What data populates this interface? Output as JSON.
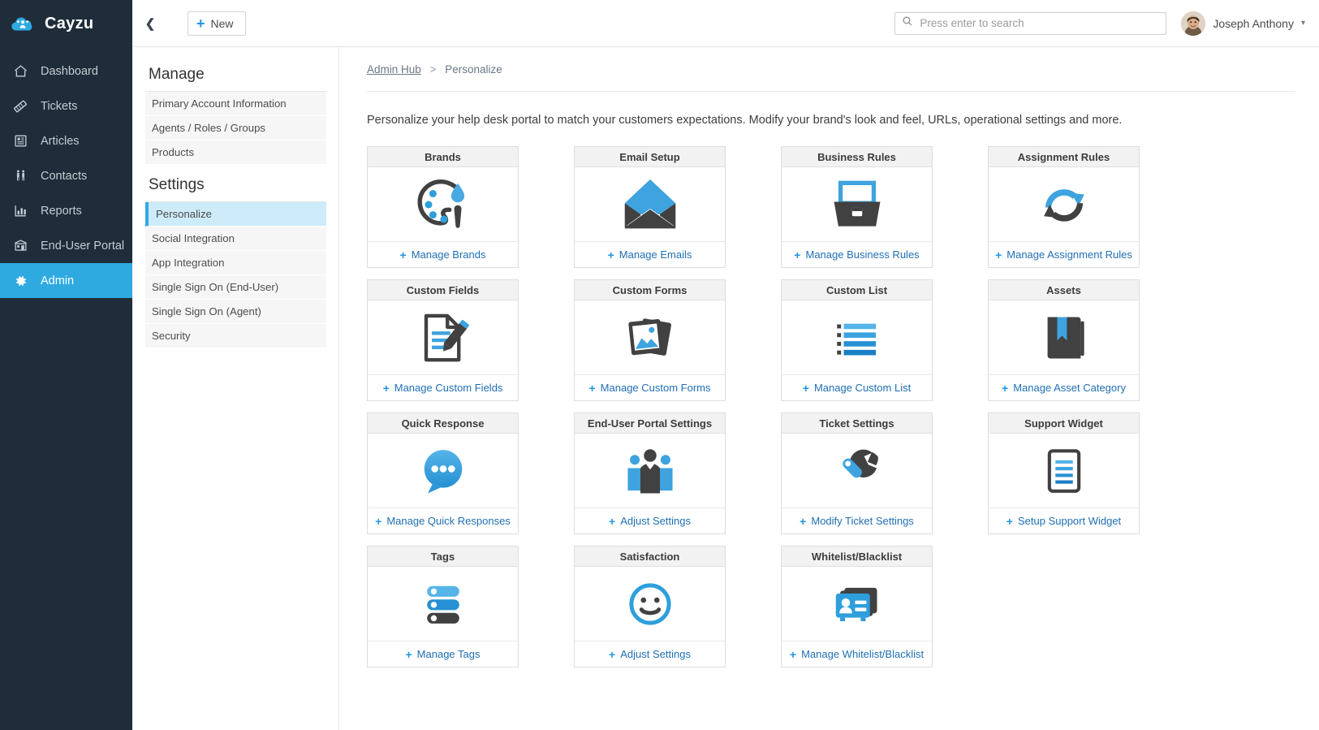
{
  "brand": {
    "name": "Cayzu",
    "logo_icon": "cloud-people-icon"
  },
  "sidebar": {
    "items": [
      {
        "label": "Dashboard",
        "icon": "home-icon",
        "active": false
      },
      {
        "label": "Tickets",
        "icon": "ticket-icon",
        "active": false
      },
      {
        "label": "Articles",
        "icon": "article-icon",
        "active": false
      },
      {
        "label": "Contacts",
        "icon": "contacts-icon",
        "active": false
      },
      {
        "label": "Reports",
        "icon": "bar-chart-icon",
        "active": false
      },
      {
        "label": "End-User Portal",
        "icon": "portal-icon",
        "active": false
      },
      {
        "label": "Admin",
        "icon": "gear-icon",
        "active": true
      }
    ]
  },
  "topbar": {
    "collapse_icon": "chevron-left-icon",
    "new_label": "New",
    "search_placeholder": "Press enter to search",
    "search_value": "",
    "search_icon": "search-icon",
    "user_name": "Joseph Anthony",
    "user_caret": "chevron-down-icon"
  },
  "manage_panel": {
    "manage_heading": "Manage",
    "manage_items": [
      "Primary Account Information",
      "Agents / Roles / Groups",
      "Products"
    ],
    "settings_heading": "Settings",
    "settings_items": [
      "Personalize",
      "Social Integration",
      "App Integration",
      "Single Sign On (End-User)",
      "Single Sign On (Agent)",
      "Security"
    ],
    "active_item": "Personalize"
  },
  "breadcrumb": {
    "root": "Admin Hub",
    "separator": ">",
    "current": "Personalize"
  },
  "page": {
    "description": "Personalize your help desk portal to match your customers expectations. Modify your brand's look and feel, URLs, operational settings and more."
  },
  "colors": {
    "sidebar_bg": "#1f2d3a",
    "accent_blue": "#2eaae1",
    "link_blue": "#1f6fb4",
    "icon_blue": "#2e9fdc",
    "icon_dark": "#414141",
    "active_item_bg": "#cdebf9"
  },
  "cards": [
    {
      "title": "Brands",
      "action": "Manage Brands",
      "icon": "palette-icon"
    },
    {
      "title": "Email Setup",
      "action": "Manage Emails",
      "icon": "envelope-icon"
    },
    {
      "title": "Business Rules",
      "action": "Manage Business Rules",
      "icon": "file-drawer-icon"
    },
    {
      "title": "Assignment Rules",
      "action": "Manage Assignment Rules",
      "icon": "refresh-cycle-icon"
    },
    {
      "title": "Custom Fields",
      "action": "Manage Custom Fields",
      "icon": "document-pencil-icon"
    },
    {
      "title": "Custom Forms",
      "action": "Manage Custom Forms",
      "icon": "photos-icon"
    },
    {
      "title": "Custom List",
      "action": "Manage Custom List",
      "icon": "bullet-list-icon"
    },
    {
      "title": "Assets",
      "action": "Manage Asset Category",
      "icon": "book-bookmark-icon"
    },
    {
      "title": "Quick Response",
      "action": "Manage Quick Responses",
      "icon": "speech-bubble-icon"
    },
    {
      "title": "End-User Portal Settings",
      "action": "Adjust Settings",
      "icon": "people-group-icon"
    },
    {
      "title": "Ticket Settings",
      "action": "Modify Ticket Settings",
      "icon": "wrench-icon"
    },
    {
      "title": "Support Widget",
      "action": "Setup Support Widget",
      "icon": "widget-document-icon"
    },
    {
      "title": "Tags",
      "action": "Manage Tags",
      "icon": "tags-icon"
    },
    {
      "title": "Satisfaction",
      "action": "Adjust Settings",
      "icon": "smiley-icon"
    },
    {
      "title": "Whitelist/Blacklist",
      "action": "Manage Whitelist/Blacklist",
      "icon": "contact-card-icon"
    }
  ]
}
